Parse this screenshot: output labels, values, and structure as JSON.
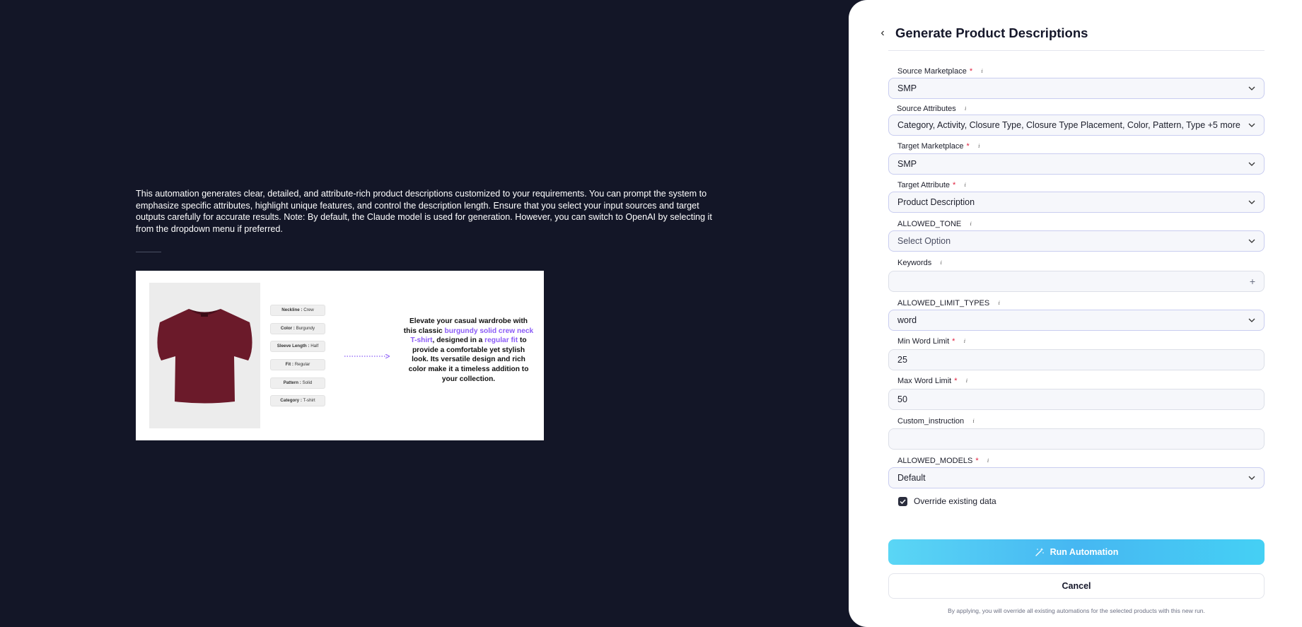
{
  "intro": {
    "description": "This automation generates clear, detailed, and attribute-rich product descriptions customized to your requirements. You can prompt the system to emphasize specific attributes, highlight unique features, and control the description length. Ensure that you select your input sources and target outputs carefully for accurate results. Note: By default, the Claude model is used for generation. However, you can switch to OpenAI by selecting it from the dropdown menu if preferred."
  },
  "illustration": {
    "attributes": [
      {
        "key": "Neckline :",
        "value": "Crew"
      },
      {
        "key": "Color :",
        "value": "Burgundy"
      },
      {
        "key": "Sleeve Length :",
        "value": "Half"
      },
      {
        "key": "Fit :",
        "value": "Regular"
      },
      {
        "key": "Pattern :",
        "value": "Solid"
      },
      {
        "key": "Category :",
        "value": "T-shirt"
      }
    ],
    "text": {
      "part1": "Elevate your casual wardrobe with this classic ",
      "hl1": "burgundy solid crew neck T-shirt",
      "part2": ", designed in a ",
      "hl2": "regular fit",
      "part3": " to provide a comfortable yet stylish look. Its versatile design and rich color make it a timeless addition to your collection."
    },
    "highlight_color": "#8b5cf6",
    "shirt_color": "#6b1a2a"
  },
  "panel": {
    "title": "Generate Product Descriptions",
    "fields": {
      "source_marketplace": {
        "label": "Source Marketplace",
        "value": "SMP"
      },
      "source_attributes": {
        "label": "Source Attributes",
        "value": "Category, Activity, Closure Type, Closure Type Placement, Color, Pattern, Type +5 more"
      },
      "target_marketplace": {
        "label": "Target Marketplace",
        "value": "SMP"
      },
      "target_attribute": {
        "label": "Target Attribute",
        "value": "Product Description"
      },
      "allowed_tone": {
        "label": "ALLOWED_TONE",
        "placeholder": "Select Option"
      },
      "keywords": {
        "label": "Keywords",
        "value": ""
      },
      "allowed_limit_types": {
        "label": "ALLOWED_LIMIT_TYPES",
        "value": "word"
      },
      "min_word_limit": {
        "label": "Min Word Limit",
        "value": "25"
      },
      "max_word_limit": {
        "label": "Max Word Limit",
        "value": "50"
      },
      "custom_instruction": {
        "label": "Custom_instruction",
        "value": ""
      },
      "allowed_models": {
        "label": "ALLOWED_MODELS",
        "value": "Default"
      }
    },
    "override_label": "Override existing data",
    "override_checked": true,
    "run_label": "Run Automation",
    "cancel_label": "Cancel",
    "footnote": "By applying, you will override all existing automations for the selected products with this new run.",
    "required_mark": "*",
    "info_glyph": "i"
  },
  "colors": {
    "background": "#131627",
    "accent_gradient_start": "#5ad6f5",
    "accent_gradient_mid": "#46b7f2",
    "required": "#e01e3c"
  }
}
